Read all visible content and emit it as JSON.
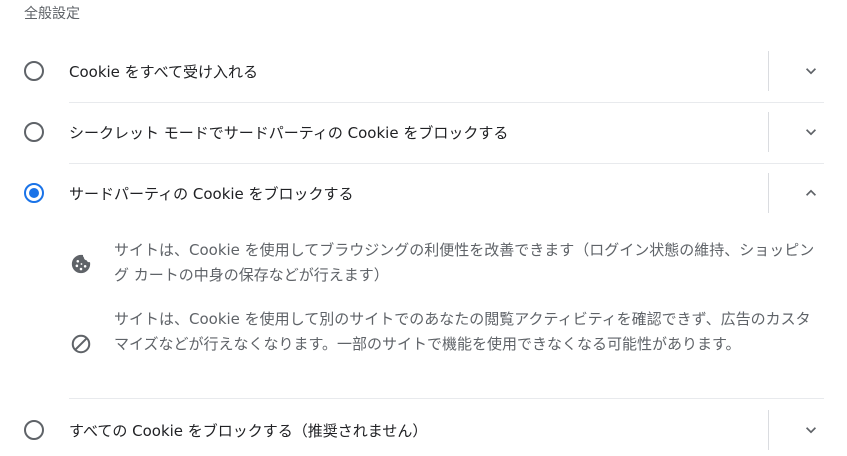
{
  "section": {
    "title": "全般設定"
  },
  "options": [
    {
      "label": "Cookie をすべて受け入れる",
      "selected": false,
      "expanded": false
    },
    {
      "label": "シークレット モードでサードパーティの Cookie をブロックする",
      "selected": false,
      "expanded": false
    },
    {
      "label": "サードパーティの Cookie をブロックする",
      "selected": true,
      "expanded": true
    },
    {
      "label": "すべての Cookie をブロックする（推奨されません）",
      "selected": false,
      "expanded": false
    }
  ],
  "details": [
    {
      "icon": "cookie-icon",
      "text": "サイトは、Cookie を使用してブラウジングの利便性を改善できます（ログイン状態の維持、ショッピング カートの中身の保存などが行えます）"
    },
    {
      "icon": "block-icon",
      "text": "サイトは、Cookie を使用して別のサイトでのあなたの閲覧アクティビティを確認できず、広告のカスタマイズなどが行えなくなります。一部のサイトで機能を使用できなくなる可能性があります。"
    }
  ],
  "colors": {
    "accent": "#1a73e8",
    "text": "#202124",
    "secondary": "#5f6368",
    "divider": "#e8eaed"
  }
}
